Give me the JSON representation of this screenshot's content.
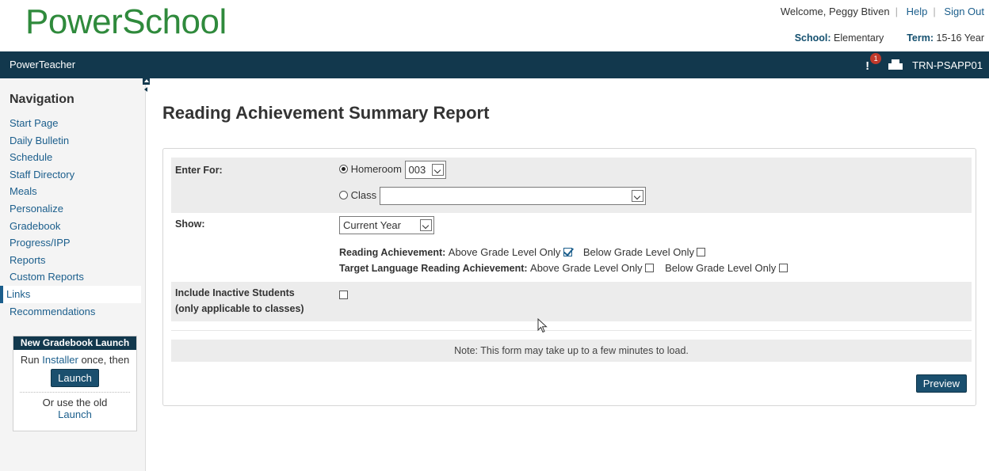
{
  "header": {
    "logo": "PowerSchool",
    "welcome": "Welcome, Peggy Btiven",
    "help": "Help",
    "sign_out": "Sign Out",
    "school_label": "School:",
    "school_value": "Elementary",
    "term_label": "Term:",
    "term_value": "15-16 Year"
  },
  "topbar": {
    "app_name": "PowerTeacher",
    "alert_count": "1",
    "server": "TRN-PSAPP01"
  },
  "sidebar": {
    "title": "Navigation",
    "items": [
      {
        "label": "Start Page"
      },
      {
        "label": "Daily Bulletin"
      },
      {
        "label": "Schedule"
      },
      {
        "label": "Staff Directory"
      },
      {
        "label": "Meals"
      },
      {
        "label": "Personalize"
      },
      {
        "label": "Gradebook"
      },
      {
        "label": "Progress/IPP"
      },
      {
        "label": "Reports"
      },
      {
        "label": "Custom Reports"
      },
      {
        "label": "Links"
      },
      {
        "label": "Recommendations"
      }
    ],
    "gradebook_box": {
      "title": "New Gradebook Launch",
      "run": "Run",
      "installer": "Installer",
      "once_then": "once, then",
      "launch_button": "Launch",
      "or_use": "Or use the old",
      "old_launch": "Launch"
    }
  },
  "main": {
    "title": "Reading Achievement Summary Report",
    "enter_for_label": "Enter For:",
    "homeroom_label": "Homeroom",
    "homeroom_value": "003",
    "class_label": "Class",
    "class_value": "",
    "show_label": "Show:",
    "show_value": "Current Year",
    "reading_label": "Reading Achievement:",
    "target_label": "Target Language Reading Achievement:",
    "above_label": "Above Grade Level Only",
    "below_label": "Below Grade Level Only",
    "reading_above_checked": true,
    "inactive_label_1": "Include Inactive Students",
    "inactive_label_2": "(only applicable to classes)",
    "note": "Note: This form may take up to a few minutes to load.",
    "preview_button": "Preview"
  }
}
